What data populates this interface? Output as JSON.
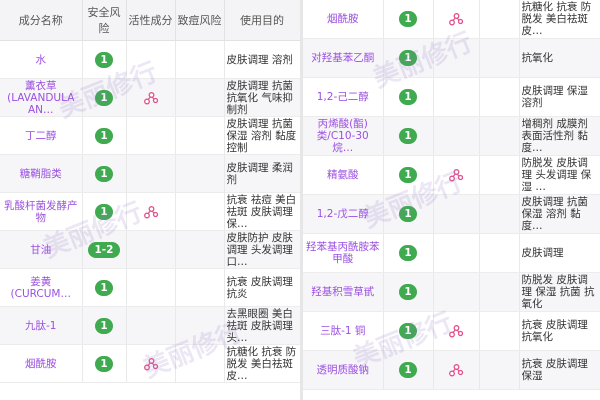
{
  "headers": {
    "name": "成分名称",
    "safety": "安全风险",
    "active": "活性成分",
    "acne": "致痘风险",
    "purpose": "使用目的"
  },
  "colors": {
    "name": "#9b4fe0",
    "badge": "#3faa4f",
    "active_icon": "#e0508a"
  },
  "watermark": "美丽修行",
  "left_rows": [
    {
      "name": "水",
      "risk": "1",
      "active": false,
      "purpose": "皮肤调理 溶剂"
    },
    {
      "name": "薰衣草(LAVANDULA AN…",
      "risk": "1",
      "active": true,
      "purpose": "皮肤调理 抗菌 抗氧化 气味抑制剂"
    },
    {
      "name": "丁二醇",
      "risk": "1",
      "active": false,
      "purpose": "皮肤调理 抗菌 保湿 溶剂 黏度控制"
    },
    {
      "name": "糖鞘脂类",
      "risk": "1",
      "active": false,
      "purpose": "皮肤调理 柔润剂"
    },
    {
      "name": "乳酸杆菌发酵产物",
      "risk": "1",
      "active": true,
      "purpose": "抗衰 祛痘 美白祛斑 皮肤调理 保…"
    },
    {
      "name": "甘油",
      "risk": "1-2",
      "active": false,
      "purpose": "皮肤防护 皮肤调理 头发调理 口…"
    },
    {
      "name": "姜黄(CURCUM…",
      "risk": "1",
      "active": false,
      "purpose": "抗衰 皮肤调理 抗炎"
    },
    {
      "name": "九肽-1",
      "risk": "1",
      "active": false,
      "purpose": "去黑眼圈 美白祛斑 皮肤调理 头…"
    },
    {
      "name": "烟酰胺",
      "risk": "1",
      "active": true,
      "purpose": "抗糖化 抗衰 防脱发 美白祛斑 皮…"
    }
  ],
  "right_rows": [
    {
      "name": "烟酰胺",
      "risk": "1",
      "active": true,
      "purpose": "抗糖化 抗衰 防脱发 美白祛斑 皮…"
    },
    {
      "name": "对羟基苯乙酮",
      "risk": "1",
      "active": false,
      "purpose": "抗氧化"
    },
    {
      "name": "1,2-己二醇",
      "risk": "1",
      "active": false,
      "purpose": "皮肤调理 保湿 溶剂"
    },
    {
      "name": "丙烯酸(酯)类/C10-30 烷…",
      "risk": "1",
      "active": false,
      "purpose": "增稠剂 成膜剂 表面活性剂 黏度…"
    },
    {
      "name": "精氨酸",
      "risk": "1",
      "active": true,
      "purpose": "防脱发 皮肤调理 头发调理 保湿 …"
    },
    {
      "name": "1,2-戊二醇",
      "risk": "1",
      "active": false,
      "purpose": "皮肤调理 抗菌 保湿 溶剂 黏度…"
    },
    {
      "name": "羟苯基丙酰胺苯甲酸",
      "risk": "1",
      "active": false,
      "purpose": "皮肤调理"
    },
    {
      "name": "羟基积雪草甙",
      "risk": "1",
      "active": false,
      "purpose": "防脱发 皮肤调理 保湿 抗菌 抗氧化"
    },
    {
      "name": "三肽-1 铜",
      "risk": "1",
      "active": true,
      "purpose": "抗衰 皮肤调理 抗氧化"
    },
    {
      "name": "透明质酸钠",
      "risk": "1",
      "active": true,
      "purpose": "抗衰 皮肤调理 保湿"
    }
  ]
}
